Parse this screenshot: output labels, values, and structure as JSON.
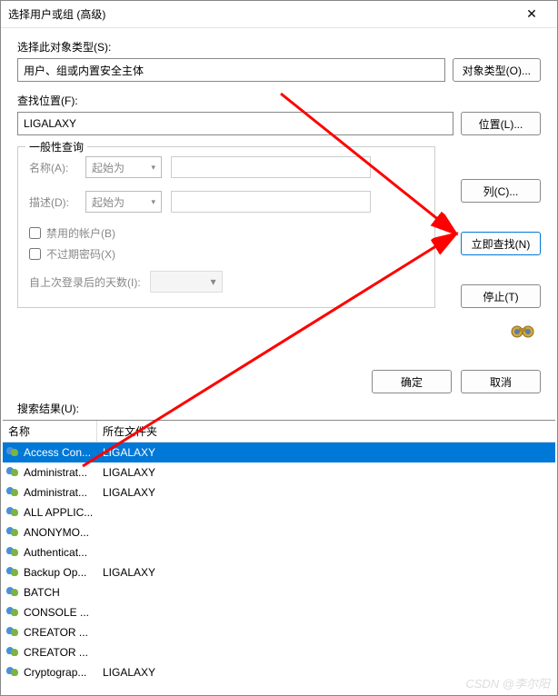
{
  "titlebar": {
    "title": "选择用户或组 (高级)",
    "close": "✕"
  },
  "objectType": {
    "label": "选择此对象类型(S):",
    "value": "用户、组或内置安全主体",
    "button": "对象类型(O)..."
  },
  "location": {
    "label": "查找位置(F):",
    "value": "LIGALAXY",
    "button": "位置(L)..."
  },
  "query": {
    "legend": "一般性查询",
    "name_label": "名称(A):",
    "desc_label": "描述(D):",
    "starts_with": "起始为",
    "chk_disabled": "禁用的帐户(B)",
    "chk_noexpire": "不过期密码(X)",
    "days_label": "自上次登录后的天数(I):"
  },
  "side": {
    "columns": "列(C)...",
    "findnow": "立即查找(N)",
    "stop": "停止(T)"
  },
  "bottom": {
    "ok": "确定",
    "cancel": "取消"
  },
  "results": {
    "label": "搜索结果(U):",
    "col_name": "名称",
    "col_folder": "所在文件夹",
    "rows": [
      {
        "name": "Access Con...",
        "folder": "LIGALAXY",
        "selected": true
      },
      {
        "name": "Administrat...",
        "folder": "LIGALAXY"
      },
      {
        "name": "Administrat...",
        "folder": "LIGALAXY"
      },
      {
        "name": "ALL APPLIC...",
        "folder": ""
      },
      {
        "name": "ANONYMO...",
        "folder": ""
      },
      {
        "name": "Authenticat...",
        "folder": ""
      },
      {
        "name": "Backup Op...",
        "folder": "LIGALAXY"
      },
      {
        "name": "BATCH",
        "folder": ""
      },
      {
        "name": "CONSOLE ...",
        "folder": ""
      },
      {
        "name": "CREATOR ...",
        "folder": ""
      },
      {
        "name": "CREATOR ...",
        "folder": ""
      },
      {
        "name": "Cryptograp...",
        "folder": "LIGALAXY"
      }
    ]
  },
  "watermark": "CSDN @李尔阳"
}
